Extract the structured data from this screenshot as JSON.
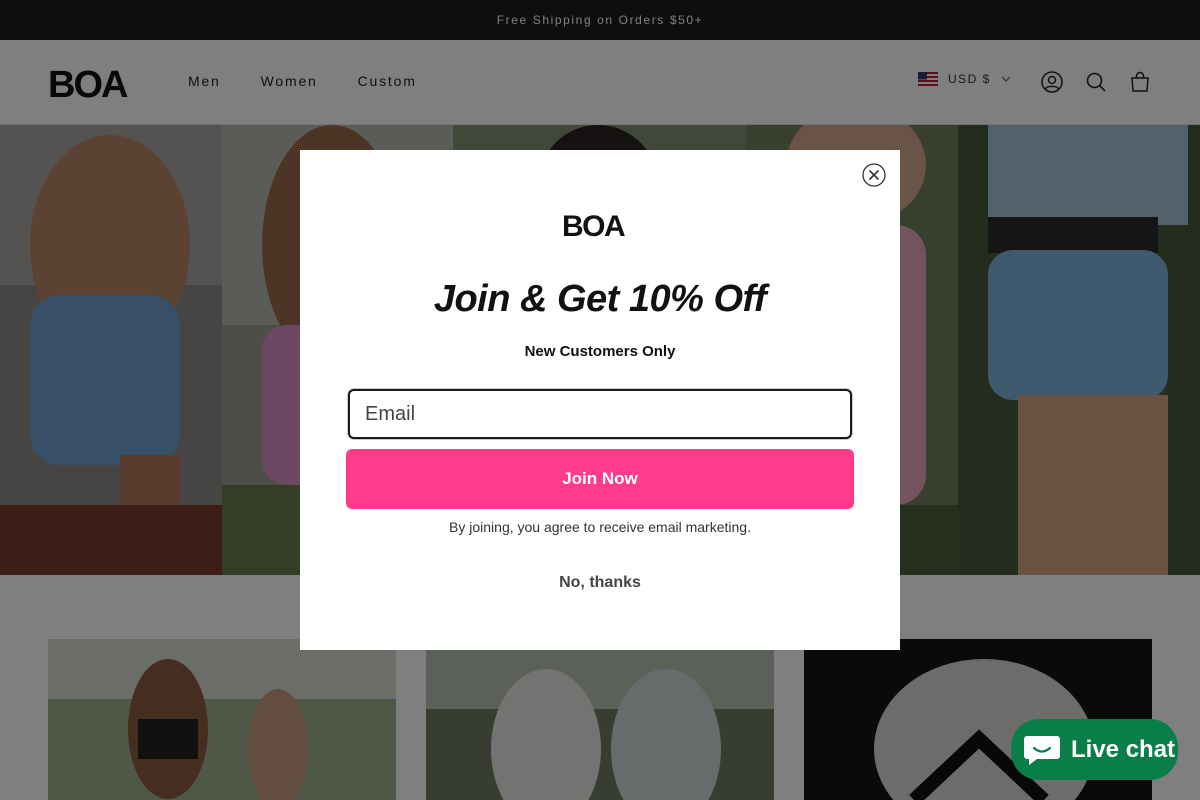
{
  "announcement": "Free Shipping on Orders $50+",
  "header": {
    "logo_text": "BOA",
    "nav": [
      "Men",
      "Women",
      "Custom"
    ],
    "currency": "USD $",
    "icons": [
      "account-icon",
      "search-icon",
      "cart-icon"
    ]
  },
  "modal": {
    "logo_text": "BOA",
    "title": "Join & Get 10% Off",
    "subtitle": "New Customers Only",
    "email_placeholder": "Email",
    "join_label": "Join Now",
    "disclaimer": "By joining, you agree to receive email marketing.",
    "decline_label": "No, thanks"
  },
  "chat": {
    "label": "Live chat"
  },
  "colors": {
    "accent": "#ff3c8c",
    "chat": "#0a7e49",
    "announcement_bg": "#1c1c1c"
  }
}
